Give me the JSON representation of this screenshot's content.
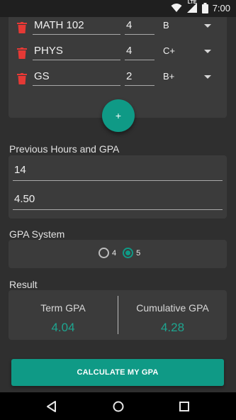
{
  "status_bar": {
    "network": "LTE",
    "time": "7:00"
  },
  "courses": [
    {
      "name": "MATH 102",
      "hours": "4",
      "grade": "B"
    },
    {
      "name": "PHYS",
      "hours": "4",
      "grade": "C+"
    },
    {
      "name": "GS",
      "hours": "2",
      "grade": "B+"
    }
  ],
  "add_button": {
    "label": "+"
  },
  "previous": {
    "label": "Previous Hours and GPA",
    "hours": "14",
    "gpa": "4.50"
  },
  "gpa_system": {
    "label": "GPA System",
    "options": [
      "4",
      "5"
    ],
    "selected": "5"
  },
  "result": {
    "label": "Result",
    "term_label": "Term GPA",
    "term_value": "4.04",
    "cumulative_label": "Cumulative GPA",
    "cumulative_value": "4.28"
  },
  "calculate_button": {
    "label": "CALCULATE MY GPA"
  },
  "colors": {
    "accent": "#0f9a86",
    "delete": "#e53935",
    "background": "#2f2f2f",
    "card": "#3b3b3b"
  },
  "icons": [
    "wifi-icon",
    "signal-icon",
    "battery-icon",
    "trash-icon",
    "dropdown-caret-icon",
    "back-icon",
    "home-icon",
    "recents-icon"
  ]
}
